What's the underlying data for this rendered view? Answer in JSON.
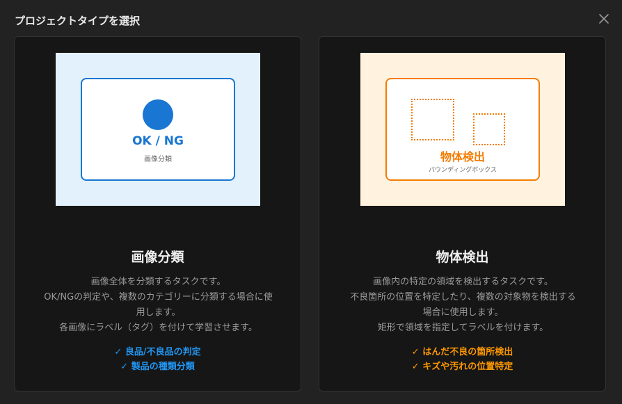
{
  "dialog": {
    "title": "プロジェクトタイプを選択",
    "close_icon": "close-icon"
  },
  "cards": [
    {
      "id": "image-classification",
      "accent": "#1976d2",
      "preview_bg": "#e3f1fd",
      "preview": {
        "label": "OK / NG",
        "sublabel": "画像分類"
      },
      "title": "画像分類",
      "description": [
        "画像全体を分類するタスクです。",
        "OK/NGの判定や、複数のカテゴリーに分類する場合に使",
        "用します。",
        "各画像にラベル（タグ）を付けて学習させます。"
      ],
      "features": [
        "✓ 良品/不良品の判定",
        "✓ 製品の種類分類"
      ]
    },
    {
      "id": "object-detection",
      "accent": "#f57c00",
      "preview_bg": "#fff3e0",
      "preview": {
        "label": "物体検出",
        "sublabel": "バウンディングボックス"
      },
      "title": "物体検出",
      "description": [
        "画像内の特定の領域を検出するタスクです。",
        "不良箇所の位置を特定したり、複数の対象物を検出する",
        "場合に使用します。",
        "矩形で領域を指定してラベルを付けます。"
      ],
      "features": [
        "✓ はんだ不良の箇所検出",
        "✓ キズや汚れの位置特定"
      ]
    }
  ]
}
